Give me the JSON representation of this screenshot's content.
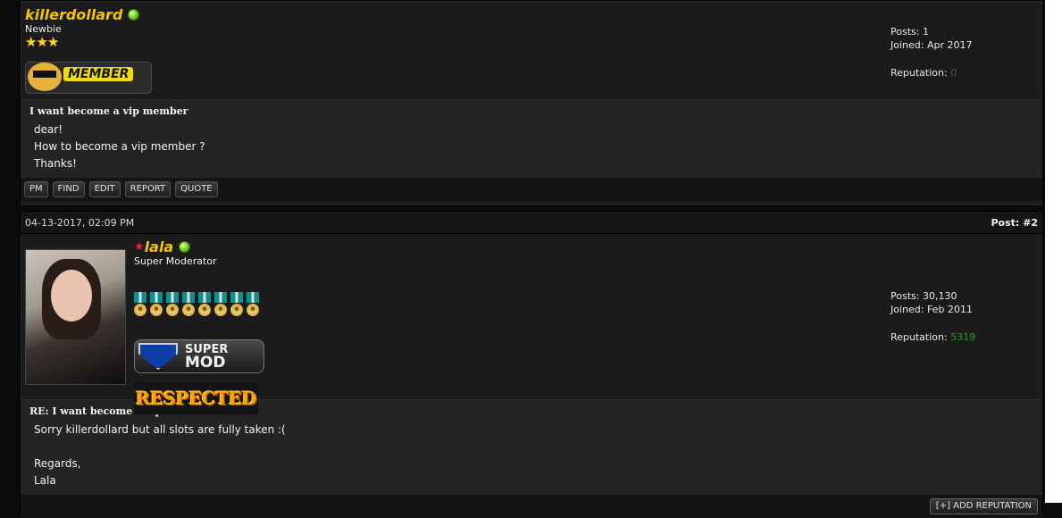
{
  "posts": [
    {
      "username": "killerdollard",
      "user_title": "Newbie",
      "stars": "★★★",
      "badge_text": "MEMBER",
      "stats": {
        "posts": "Posts: 1",
        "joined": "Joined: Apr 2017",
        "reputation_label": "Reputation:",
        "reputation_value": "0"
      },
      "title": "I want become a vip member",
      "body": [
        "dear!",
        "How to become a vip member ?",
        "Thanks!"
      ],
      "buttons": [
        "PM",
        "FIND",
        "EDIT",
        "REPORT",
        "QUOTE"
      ]
    },
    {
      "date": "04-13-2017, 02:09 PM",
      "post_number": "Post: #2",
      "username": "lala",
      "user_title": "Super Moderator",
      "medal_count": 8,
      "badges": {
        "supermod_line1": "SUPER",
        "supermod_line2": "MOD",
        "respected": "RESPECTED"
      },
      "stats": {
        "posts": "Posts: 30,130",
        "joined": "Joined: Feb 2011",
        "reputation_label": "Reputation:",
        "reputation_value": "5319"
      },
      "title": "RE: I want become a vip member",
      "body": [
        "Sorry killerdollard but all slots are fully taken :(",
        "",
        "Regards,",
        "Lala"
      ],
      "add_reputation": "[+] ADD REPUTATION"
    }
  ],
  "colors": {
    "username": "#f5c400",
    "online": "#52b800",
    "reputation_positive": "#22a022",
    "reputation_zero": "#555555"
  }
}
